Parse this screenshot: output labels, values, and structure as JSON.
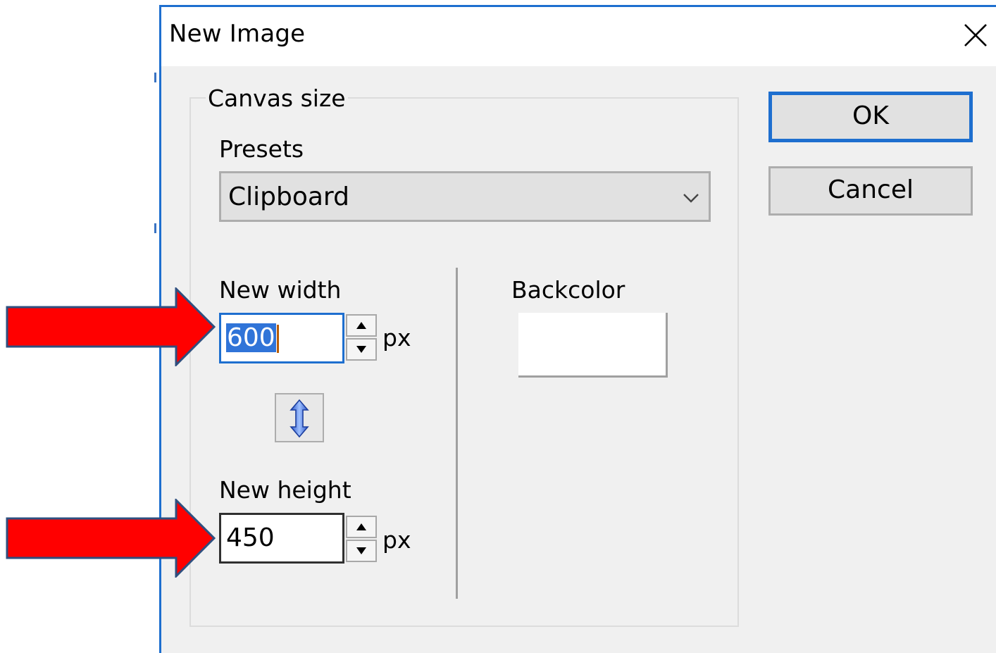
{
  "dialog": {
    "title": "New Image",
    "group_label": "Canvas size",
    "presets_label": "Presets",
    "presets_value": "Clipboard",
    "width_label": "New width",
    "width_value": "600",
    "width_unit": "px",
    "height_label": "New height",
    "height_value": "450",
    "height_unit": "px",
    "backcolor_label": "Backcolor",
    "backcolor_value": "#ffffff",
    "ok_label": "OK",
    "cancel_label": "Cancel"
  },
  "icons": {
    "close": "close-icon",
    "dropdown": "chevron-down-icon",
    "spin_up": "triangle-up-icon",
    "spin_down": "triangle-down-icon",
    "link": "vertical-double-arrow-icon",
    "annotation": "red-arrow-right-icon"
  },
  "colors": {
    "accent": "#1e6fcf",
    "selection": "#3074d8",
    "annotation_arrow": "#ff0000",
    "dialog_bg": "#f0f0f0"
  }
}
